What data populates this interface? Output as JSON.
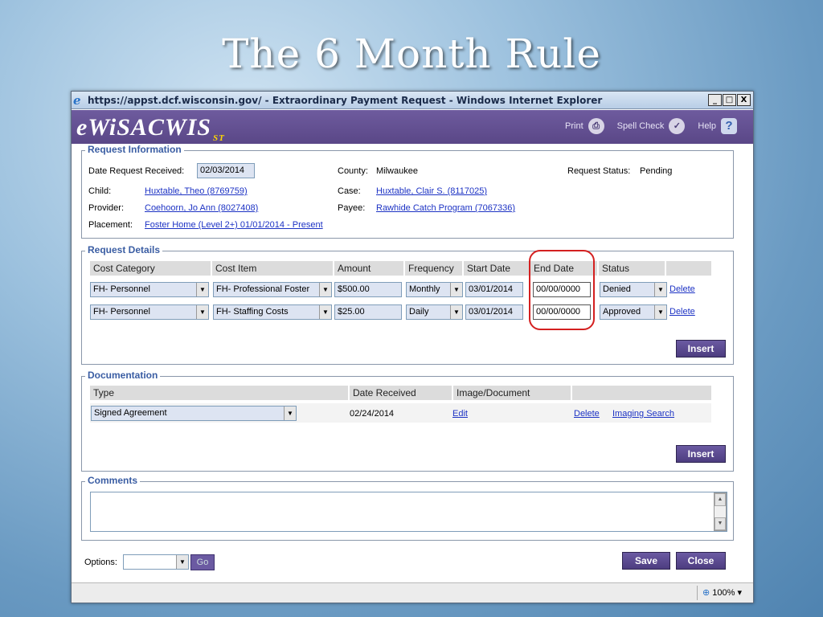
{
  "slide_title": "The 6 Month Rule",
  "window": {
    "title": "https://appst.dcf.wisconsin.gov/ - Extraordinary Payment Request - Windows Internet Explorer",
    "controls": [
      "_",
      "□",
      "X"
    ]
  },
  "app": {
    "logo": "eWiSACWIS",
    "logo_suffix": "ST",
    "tools": {
      "print": "Print",
      "spell_check": "Spell Check",
      "help": "Help"
    }
  },
  "request_info": {
    "legend": "Request Information",
    "date_received_label": "Date Request Received:",
    "date_received_value": "02/03/2014",
    "county_label": "County:",
    "county_value": "Milwaukee",
    "status_label": "Request Status:",
    "status_value": "Pending",
    "child_label": "Child:",
    "child_value": "Huxtable, Theo (8769759)",
    "case_label": "Case:",
    "case_value": "Huxtable, Clair S. (8117025)",
    "provider_label": "Provider:",
    "provider_value": "Coehoorn, Jo Ann (8027408)",
    "payee_label": "Payee:",
    "payee_value": "Rawhide Catch Program (7067336)",
    "placement_label": "Placement:",
    "placement_value": "Foster Home (Level 2+) 01/01/2014 - Present"
  },
  "request_details": {
    "legend": "Request Details",
    "headers": [
      "Cost Category",
      "Cost Item",
      "Amount",
      "Frequency",
      "Start Date",
      "End Date",
      "Status"
    ],
    "rows": [
      {
        "category": "FH- Personnel",
        "item": "FH- Professional Foster",
        "amount": "$500.00",
        "frequency": "Monthly",
        "start": "03/01/2014",
        "end": "00/00/0000",
        "status": "Denied",
        "delete": "Delete"
      },
      {
        "category": "FH- Personnel",
        "item": "FH- Staffing Costs",
        "amount": "$25.00",
        "frequency": "Daily",
        "start": "03/01/2014",
        "end": "00/00/0000",
        "status": "Approved",
        "delete": "Delete"
      }
    ],
    "insert_label": "Insert"
  },
  "documentation": {
    "legend": "Documentation",
    "headers": [
      "Type",
      "Date Received",
      "Image/Document"
    ],
    "row": {
      "type": "Signed Agreement",
      "date": "02/24/2014",
      "edit": "Edit",
      "delete": "Delete",
      "imaging": "Imaging Search"
    },
    "insert_label": "Insert"
  },
  "comments": {
    "legend": "Comments",
    "value": ""
  },
  "footer": {
    "options_label": "Options:",
    "options_value": "",
    "go_label": "Go",
    "save_label": "Save",
    "close_label": "Close"
  },
  "statusbar": {
    "zoom": "100%"
  },
  "colors": {
    "accent": "#5a4787",
    "link": "#1c32c4",
    "legend": "#3a5da3",
    "highlight": "#d42020"
  }
}
